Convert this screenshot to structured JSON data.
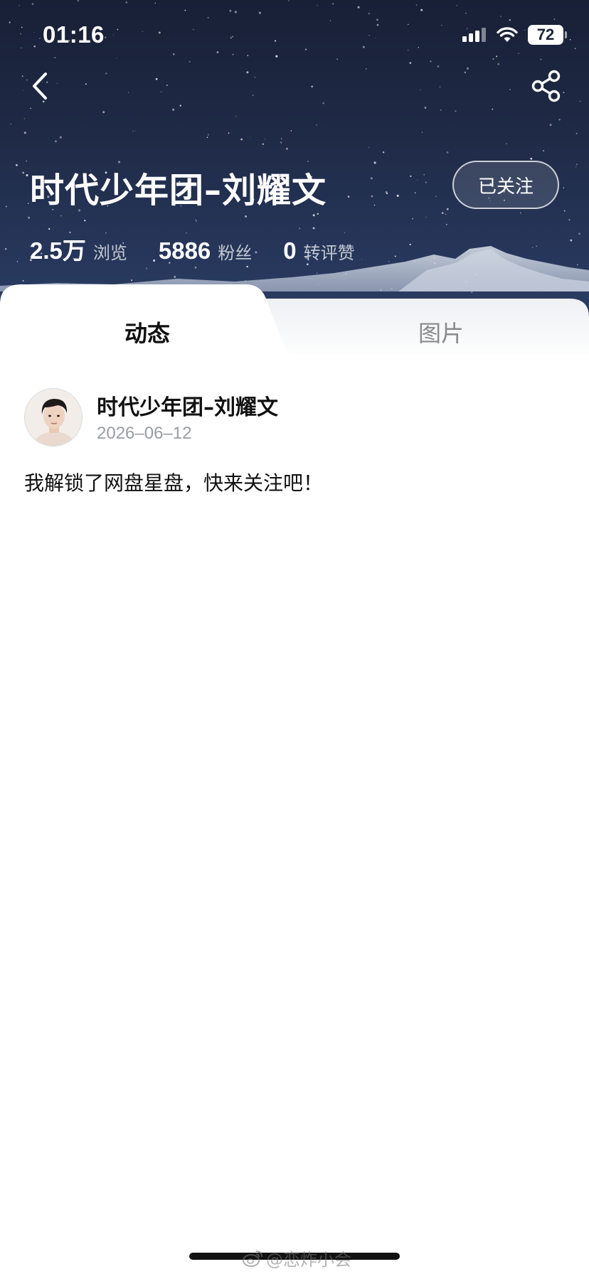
{
  "status_bar": {
    "time": "01:16",
    "battery": "72",
    "icons": [
      "signal-icon",
      "wifi-icon",
      "battery-icon"
    ]
  },
  "nav": {
    "back_icon": "chevron-left-icon",
    "share_icon": "share-icon"
  },
  "profile": {
    "title": "时代少年团–刘耀文",
    "follow_label": "已关注",
    "stats": [
      {
        "value": "2.5万",
        "label": "浏览"
      },
      {
        "value": "5886",
        "label": "粉丝"
      },
      {
        "value": "0",
        "label": "转评赞"
      }
    ]
  },
  "tabs": [
    {
      "label": "动态",
      "active": true
    },
    {
      "label": "图片",
      "active": false
    }
  ],
  "post": {
    "author": "时代少年团–刘耀文",
    "date": "2026–06–12",
    "text": "我解锁了网盘星盘，快来关注吧！"
  },
  "watermark": {
    "text": "@恋炸小会",
    "icon": "weibo-icon"
  },
  "colors": {
    "header_bg": "#1f2a46",
    "date_gray": "#9a9ca4",
    "inactive_tab": "#8a8a8a"
  }
}
